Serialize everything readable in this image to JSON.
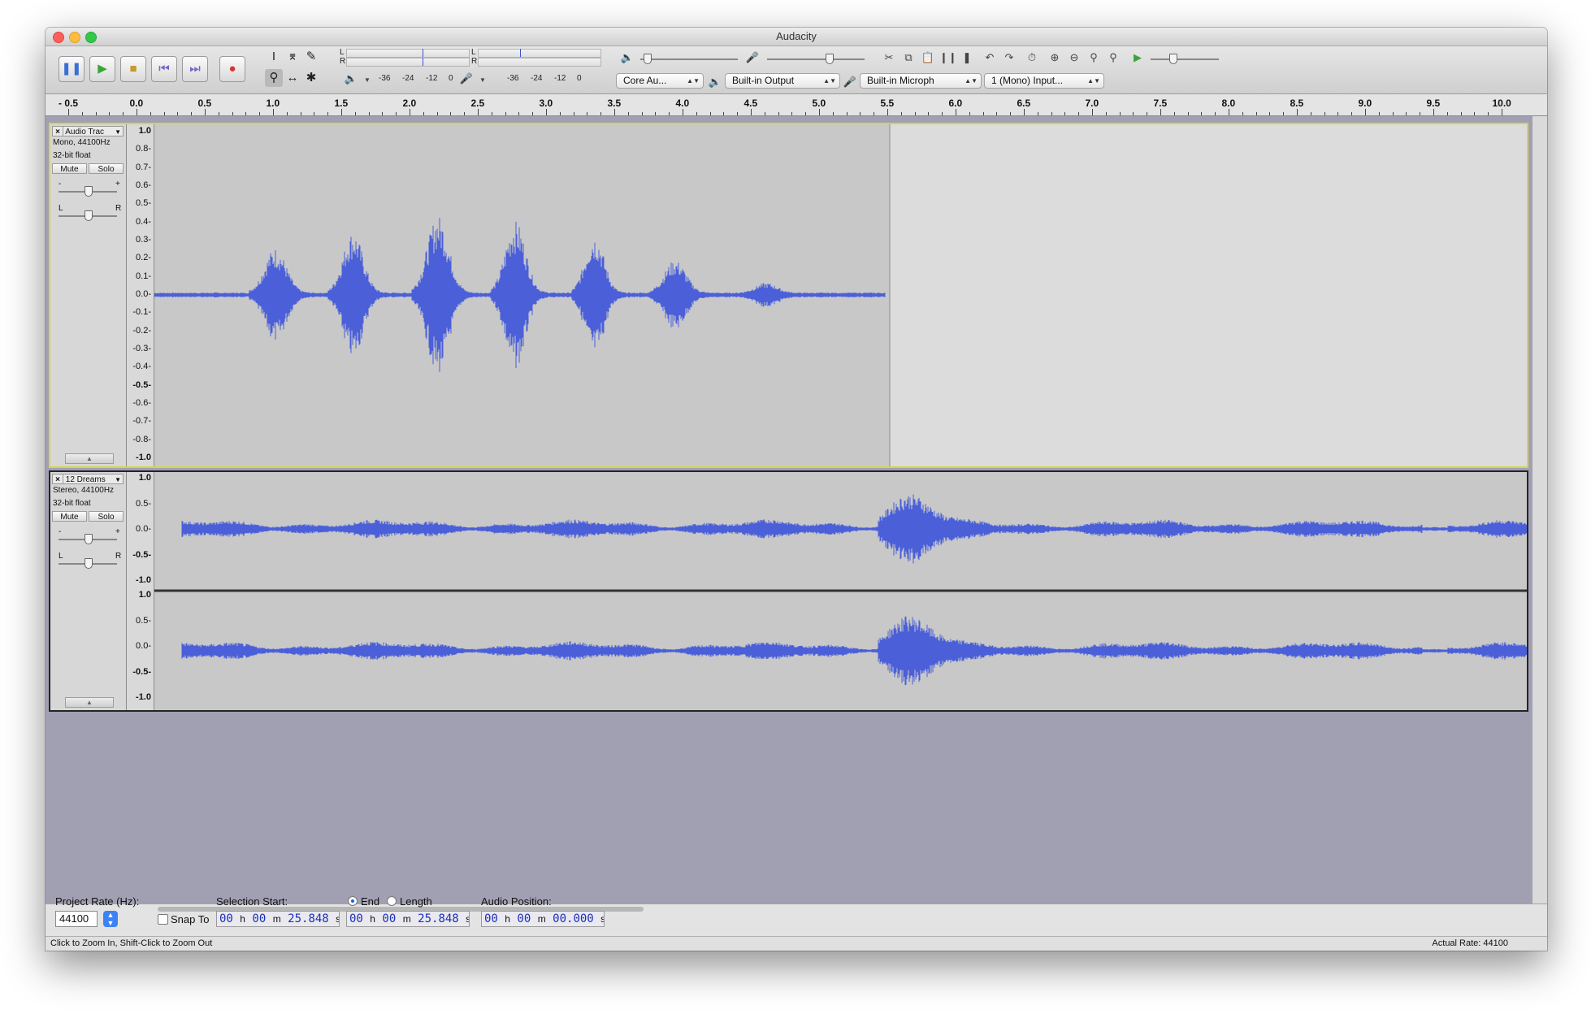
{
  "window": {
    "title": "Audacity"
  },
  "meters": {
    "play_scale": [
      "-36",
      "-24",
      "-12",
      "0"
    ],
    "rec_scale": [
      "-36",
      "-24",
      "-12",
      "0"
    ],
    "left": "L",
    "right": "R"
  },
  "devices": {
    "host": "Core Au...",
    "output": "Built-in Output",
    "input": "Built-in Microph",
    "channels": "1 (Mono) Input..."
  },
  "ruler": {
    "labels": [
      "- 0.5",
      "0.0",
      "0.5",
      "1.0",
      "1.5",
      "2.0",
      "2.5",
      "3.0",
      "3.5",
      "4.0",
      "4.5",
      "5.0",
      "5.5",
      "6.0",
      "6.5",
      "7.0",
      "7.5",
      "8.0",
      "8.5",
      "9.0",
      "9.5",
      "10.0"
    ]
  },
  "tracks": [
    {
      "name": "Audio Trac",
      "format": "Mono, 44100Hz",
      "depth": "32-bit float",
      "mute": "Mute",
      "solo": "Solo",
      "gain_minus": "-",
      "gain_plus": "+",
      "pan_left": "L",
      "pan_right": "R",
      "scale": [
        "1.0",
        "0.8-",
        "0.7-",
        "0.6-",
        "0.5-",
        "0.4-",
        "0.3-",
        "0.2-",
        "0.1-",
        "0.0-",
        "-0.1-",
        "-0.2-",
        "-0.3-",
        "-0.4-",
        "-0.5-",
        "-0.6-",
        "-0.7-",
        "-0.8-",
        "-1.0"
      ]
    },
    {
      "name": "12 Dreams",
      "format": "Stereo, 44100Hz",
      "depth": "32-bit float",
      "mute": "Mute",
      "solo": "Solo",
      "gain_minus": "-",
      "gain_plus": "+",
      "pan_left": "L",
      "pan_right": "R",
      "scale_left": [
        "1.0",
        "0.5-",
        "0.0-",
        "-0.5-",
        "-1.0"
      ],
      "scale_right": [
        "1.0",
        "0.5-",
        "0.0-",
        "-0.5-",
        "-1.0"
      ]
    }
  ],
  "bottom": {
    "project_rate_label": "Project Rate (Hz):",
    "project_rate_value": "44100",
    "snap_to": "Snap To",
    "selection_start_label": "Selection Start:",
    "end_label": "End",
    "length_label": "Length",
    "audio_position_label": "Audio Position:",
    "selection_start": {
      "h": "00",
      "m": "00",
      "s": "25.848"
    },
    "selection_end": {
      "h": "00",
      "m": "00",
      "s": "25.848"
    },
    "audio_position": {
      "h": "00",
      "m": "00",
      "s": "00.000"
    },
    "unit_h": "h",
    "unit_m": "m",
    "unit_s": "s"
  },
  "status": {
    "hint": "Click to Zoom In, Shift-Click to Zoom Out",
    "actual_rate": "Actual Rate: 44100"
  },
  "colors": {
    "waveform": "#4a5fd8",
    "selected_track_border": "#d6d645",
    "workspace": "#a1a0b3"
  }
}
